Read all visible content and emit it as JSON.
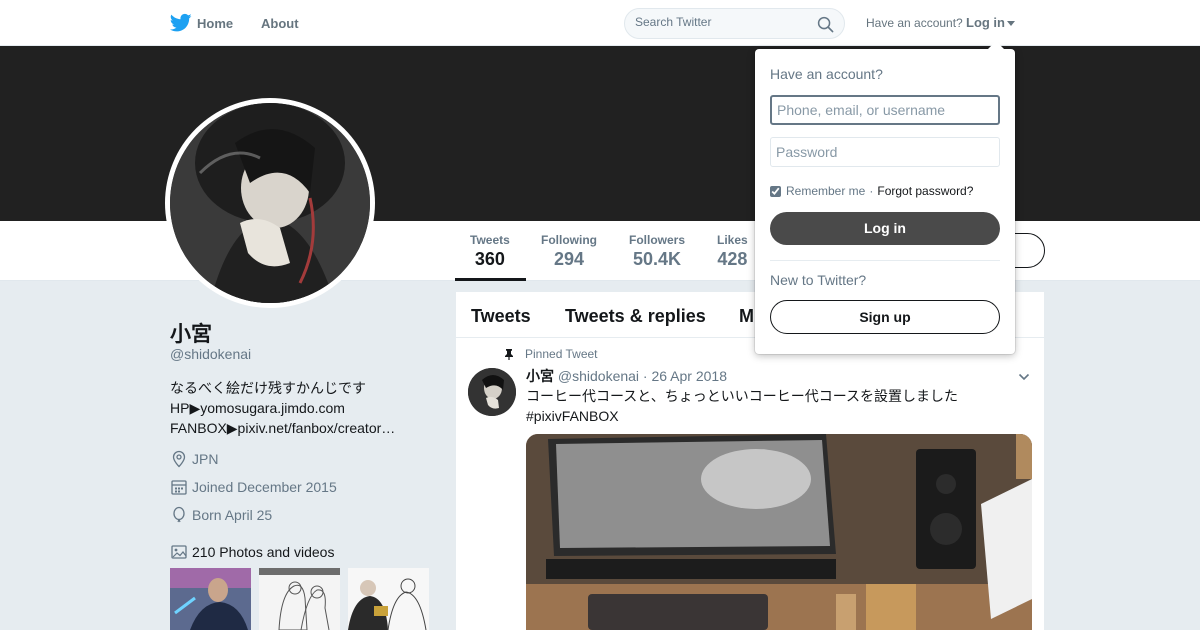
{
  "nav": {
    "home_label": "Home",
    "about_label": "About",
    "search_placeholder": "Search Twitter",
    "have_account": "Have an account?",
    "login_label": "Log in"
  },
  "stats": [
    {
      "label": "Tweets",
      "value": "360"
    },
    {
      "label": "Following",
      "value": "294"
    },
    {
      "label": "Followers",
      "value": "50.4K"
    },
    {
      "label": "Likes",
      "value": "428"
    }
  ],
  "profile": {
    "name": "小宮",
    "handle": "@shidokenai",
    "bio": [
      "なるべく絵だけ残すかんじです",
      "HP▶yomosugara.jimdo.com",
      "FANBOX▶pixiv.net/fanbox/creator…"
    ],
    "location": "JPN",
    "joined": "Joined December 2015",
    "born": "Born April 25",
    "photos_label": "210 Photos and videos"
  },
  "timeline": {
    "tabs": [
      "Tweets",
      "Tweets & replies",
      "M"
    ],
    "pinned_label": "Pinned Tweet",
    "tweet": {
      "name": "小宮",
      "meta": "@shidokenai · 26 Apr 2018",
      "text_line1": "コーヒー代コースと、ちょっといいコーヒー代コースを設置しました",
      "text_line2": "#pixivFANBOX"
    }
  },
  "login_dropdown": {
    "title": "Have an account?",
    "username_placeholder": "Phone, email, or username",
    "password_placeholder": "Password",
    "remember_label": "Remember me",
    "separator": "·",
    "forgot_label": "Forgot password?",
    "login_button": "Log in",
    "new_label": "New to Twitter?",
    "signup_button": "Sign up"
  },
  "colors": {
    "banner": "#212121",
    "page_bg": "#e6ecf0",
    "brand": "#1da1f2"
  }
}
